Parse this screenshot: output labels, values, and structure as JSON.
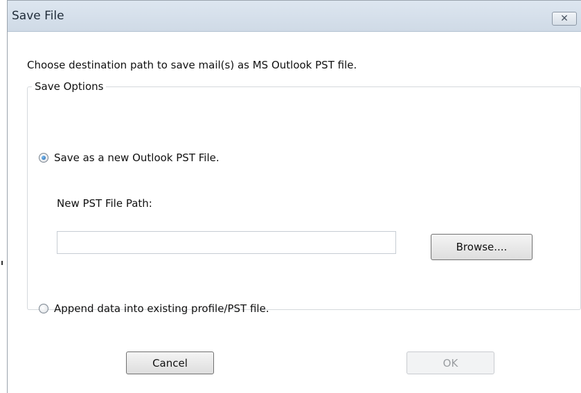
{
  "window": {
    "title": "Save File",
    "close_icon_char": "✕"
  },
  "instruction": "Choose destination path to save mail(s) as MS Outlook PST file.",
  "save_options": {
    "legend": "Save Options",
    "option_new": {
      "label": "Save as a new Outlook PST File.",
      "checked": true
    },
    "path_label": "New PST File Path:",
    "path_value": "",
    "browse_label": "Browse....",
    "option_append": {
      "label": "Append data into existing profile/PST file.",
      "checked": false
    }
  },
  "buttons": {
    "cancel_label": "Cancel",
    "ok_label": "OK",
    "ok_enabled": false
  },
  "colors": {
    "titlebar": "#d6e0ea",
    "radio_selected": "#1c5fa6",
    "disabled_text": "#9a9da1"
  }
}
